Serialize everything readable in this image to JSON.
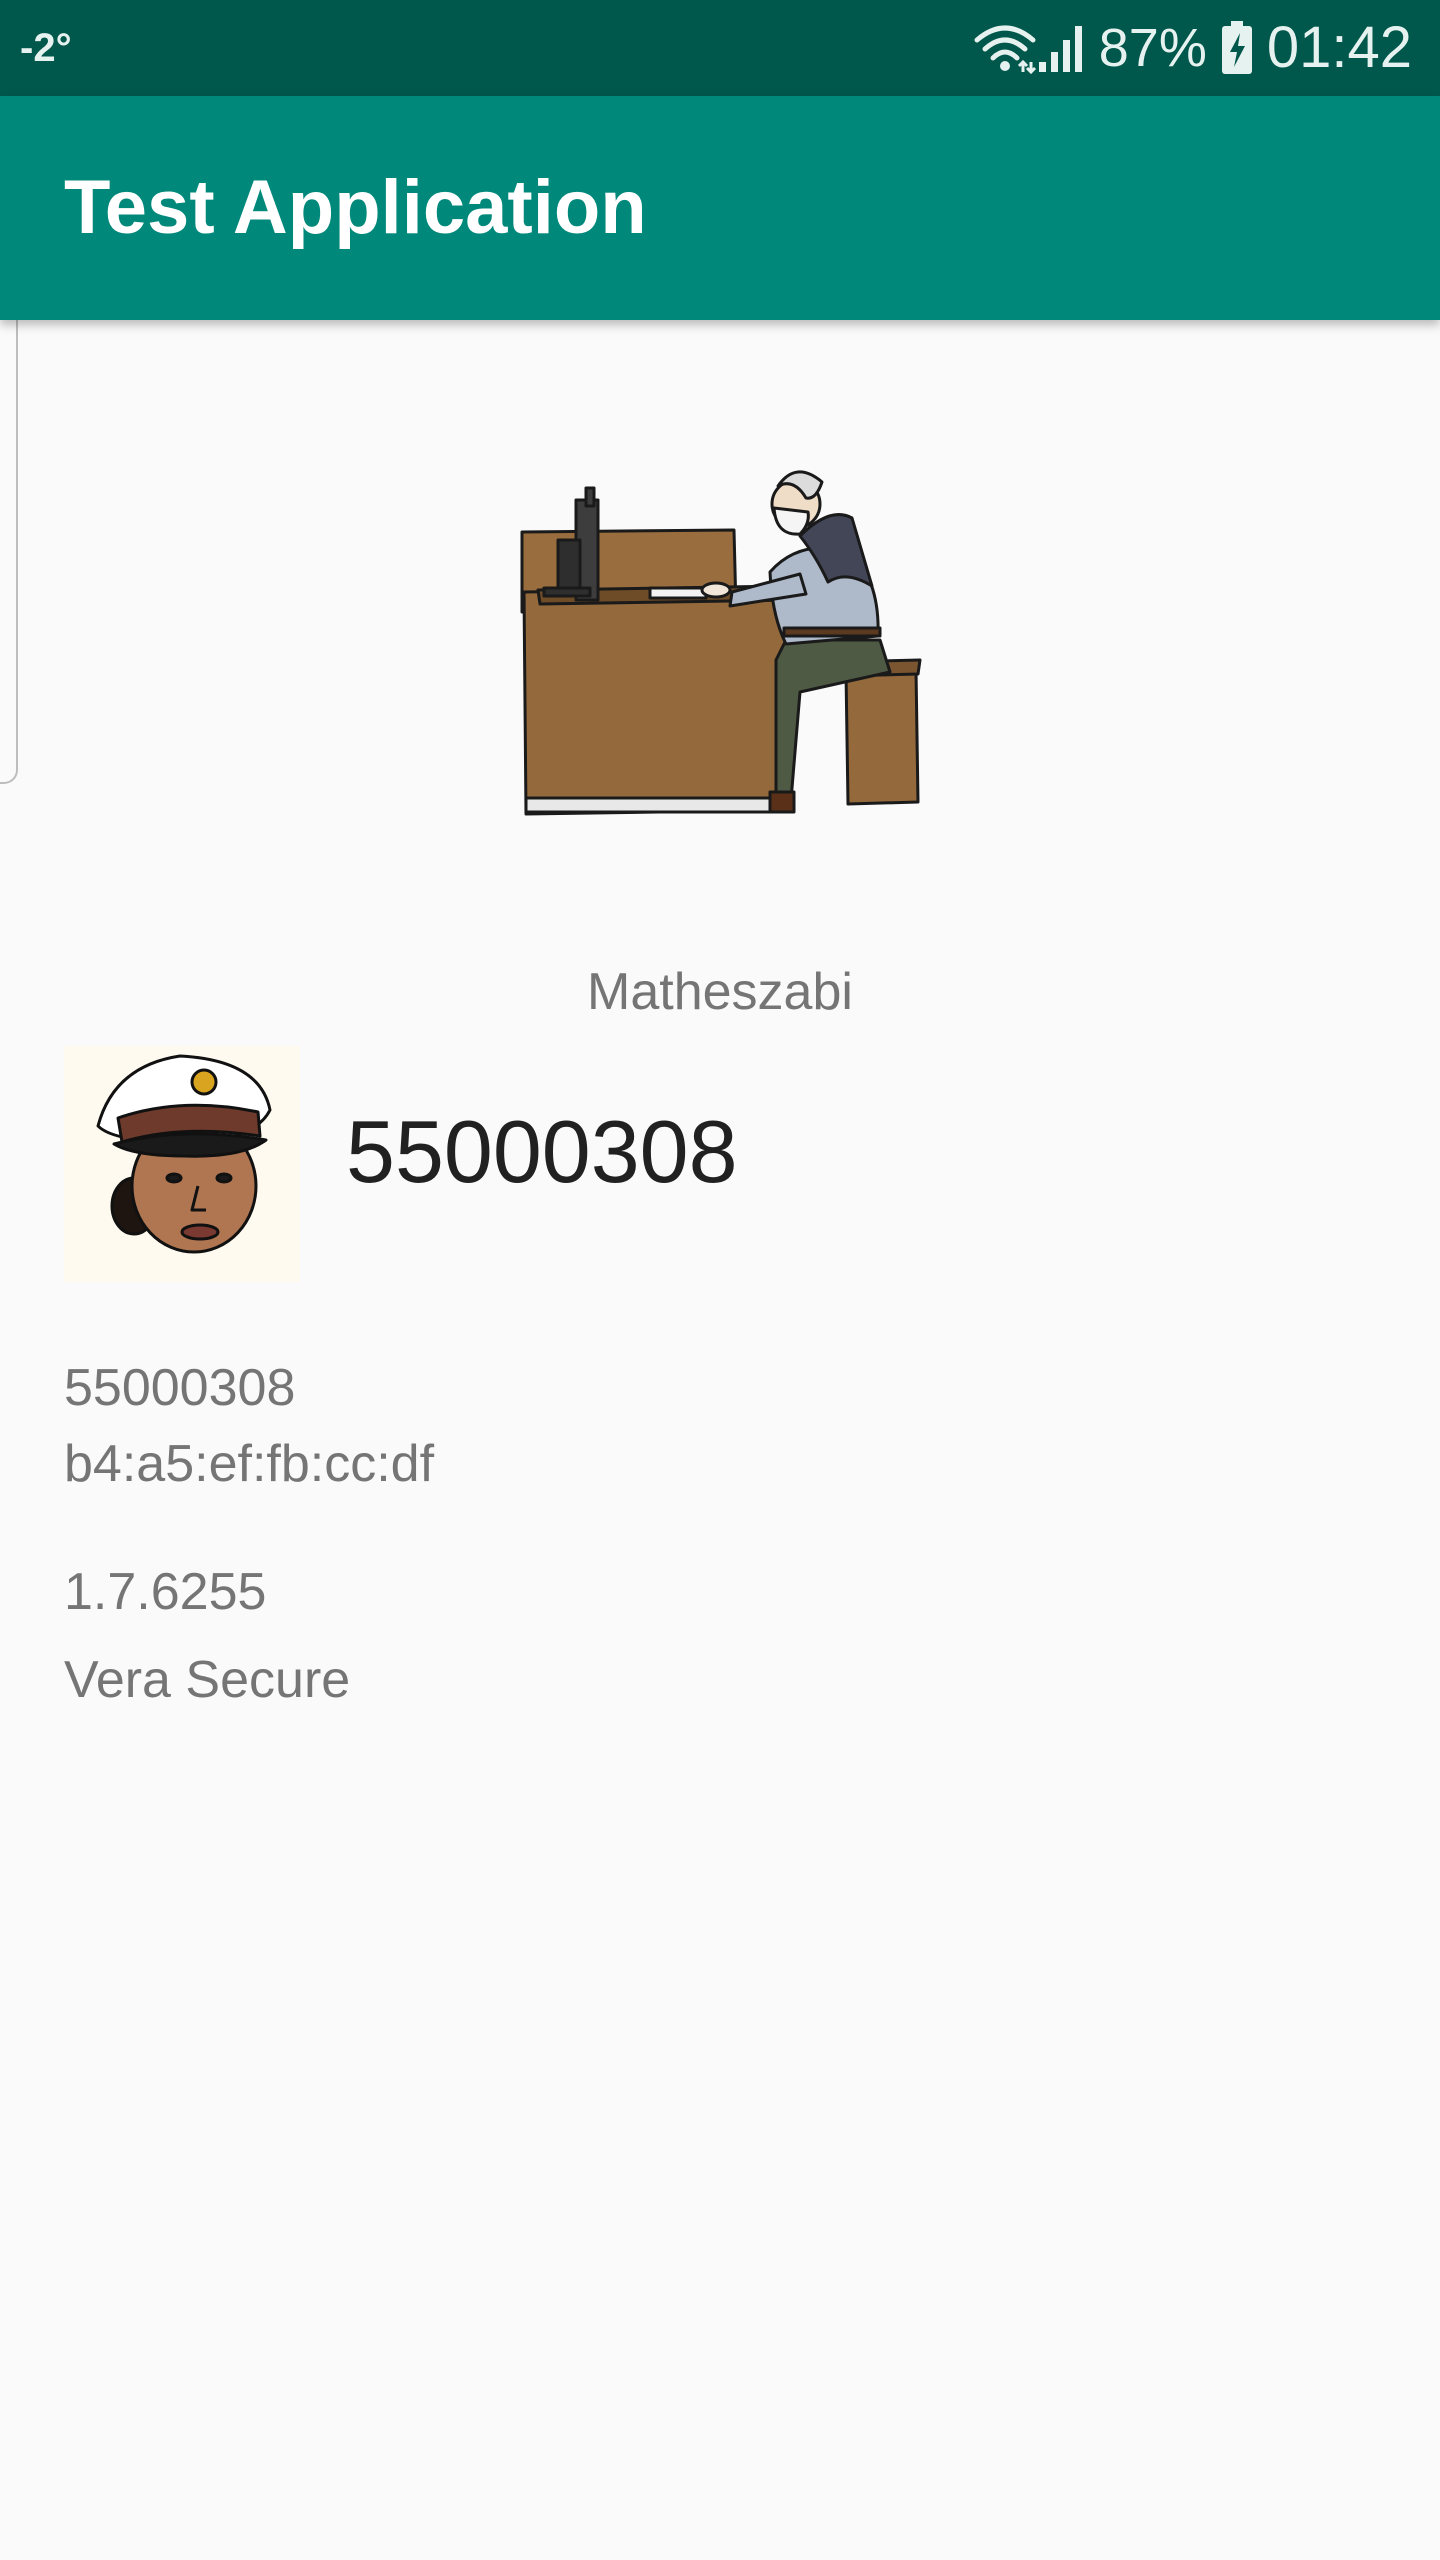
{
  "status_bar": {
    "temperature": "-2°",
    "battery_percent": "87%",
    "time": "01:42",
    "icons": [
      "wifi-icon",
      "signal-icon",
      "battery-charging-icon"
    ],
    "colors": {
      "background": "#00574b",
      "foreground": "#e6f2ef"
    }
  },
  "app_bar": {
    "title": "Test Application",
    "color": "#00897b"
  },
  "profile": {
    "hero_image": "person-at-computer-desk-illustration",
    "username": "Matheszabi",
    "avatar": "police-officer-avatar",
    "device_id_large": "55000308"
  },
  "details": {
    "device_id": "55000308",
    "mac_address": "b4:a5:ef:fb:cc:df",
    "version": "1.7.6255",
    "product": "Vera Secure"
  }
}
